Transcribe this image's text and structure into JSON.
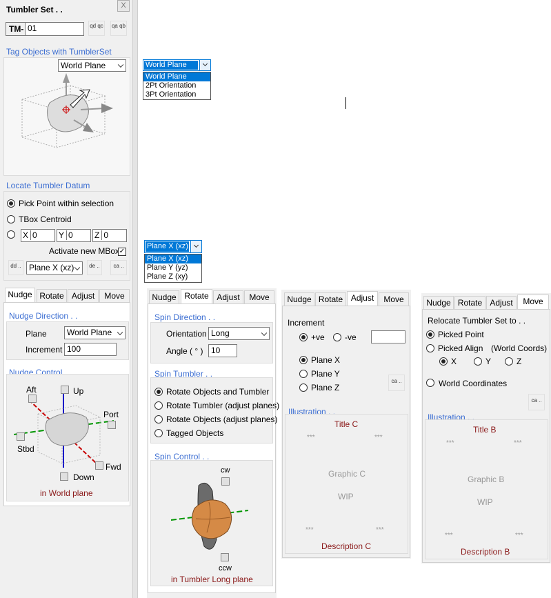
{
  "window": {
    "title": "Tumbler Set . .",
    "close_label": "X"
  },
  "tm": {
    "prefix": "TM-",
    "value": "01",
    "btn1": "qd qc",
    "btn2": "qa qb"
  },
  "tag": {
    "title": "Tag Objects with TumblerSet",
    "plane": "World Plane"
  },
  "datum": {
    "title": "Locate Tumbler Datum",
    "opt_pick": "Pick Point within selection",
    "opt_tbox": "TBox Centroid",
    "x_label": "X",
    "x_value": "0",
    "y_label": "Y",
    "y_value": "0",
    "z_label": "Z",
    "z_value": "0",
    "activate_label": "Activate new MBox",
    "activate_checked": "✓",
    "icon_btn1": "dd ..",
    "plane": "Plane X (xz)",
    "icon_btn2": "de ..",
    "icon_btn3": "ca .."
  },
  "tabs": [
    "Nudge",
    "Rotate",
    "Adjust",
    "Move"
  ],
  "nudge": {
    "dir_title": "Nudge Direction . .",
    "plane_label": "Plane",
    "plane_value": "World Plane",
    "increment_label": "Increment",
    "increment_value": "100",
    "control_title": "Nudge Control . .",
    "aft": "Aft",
    "up": "Up",
    "port": "Port",
    "stbd": "Stbd",
    "fwd": "Fwd",
    "down": "Down",
    "caption": "in World plane"
  },
  "dropdown1": {
    "selected": "World Plane",
    "options": [
      "World Plane",
      "2Pt Orientation",
      "3Pt Orientation"
    ]
  },
  "dropdown2": {
    "selected": "Plane X (xz)",
    "options": [
      "Plane X (xz)",
      "Plane Y (yz)",
      "Plane Z (xy)"
    ]
  },
  "rotate": {
    "dir_title": "Spin Direction . .",
    "orientation_label": "Orientation",
    "orientation_value": "Long",
    "angle_label": "Angle ( ° )",
    "angle_value": "10",
    "tumbler_title": "Spin Tumbler . .",
    "opt1": "Rotate Objects and Tumbler",
    "opt2": "Rotate Tumbler (adjust planes)",
    "opt3": "Rotate Objects (adjust planes)",
    "opt4": "Tagged Objects",
    "control_title": "Spin Control . .",
    "cw": "cw",
    "ccw": "ccw",
    "caption": "in Tumbler Long plane"
  },
  "adjust": {
    "increment_label": "Increment",
    "pos": "+ve",
    "neg": "-ve",
    "value": "",
    "plane_x": "Plane X",
    "plane_y": "Plane Y",
    "plane_z": "Plane Z",
    "icon_btn": "ca ..",
    "illus_title": "Illustration . .",
    "title": "Title C",
    "stars": "***",
    "graphic": "Graphic C",
    "wip": "WIP",
    "description": "Description C"
  },
  "move": {
    "relocate_label": "Relocate Tumbler Set to . .",
    "opt_picked_point": "Picked Point",
    "opt_picked_align": "Picked Align",
    "world_coords": "(World Coords)",
    "x": "X",
    "y": "Y",
    "z": "Z",
    "opt_world": "World Coordinates",
    "icon_btn": "ca ..",
    "illus_title": "Illustration . .",
    "title": "Title B",
    "stars": "***",
    "graphic": "Graphic B",
    "wip": "WIP",
    "description": "Description B"
  }
}
